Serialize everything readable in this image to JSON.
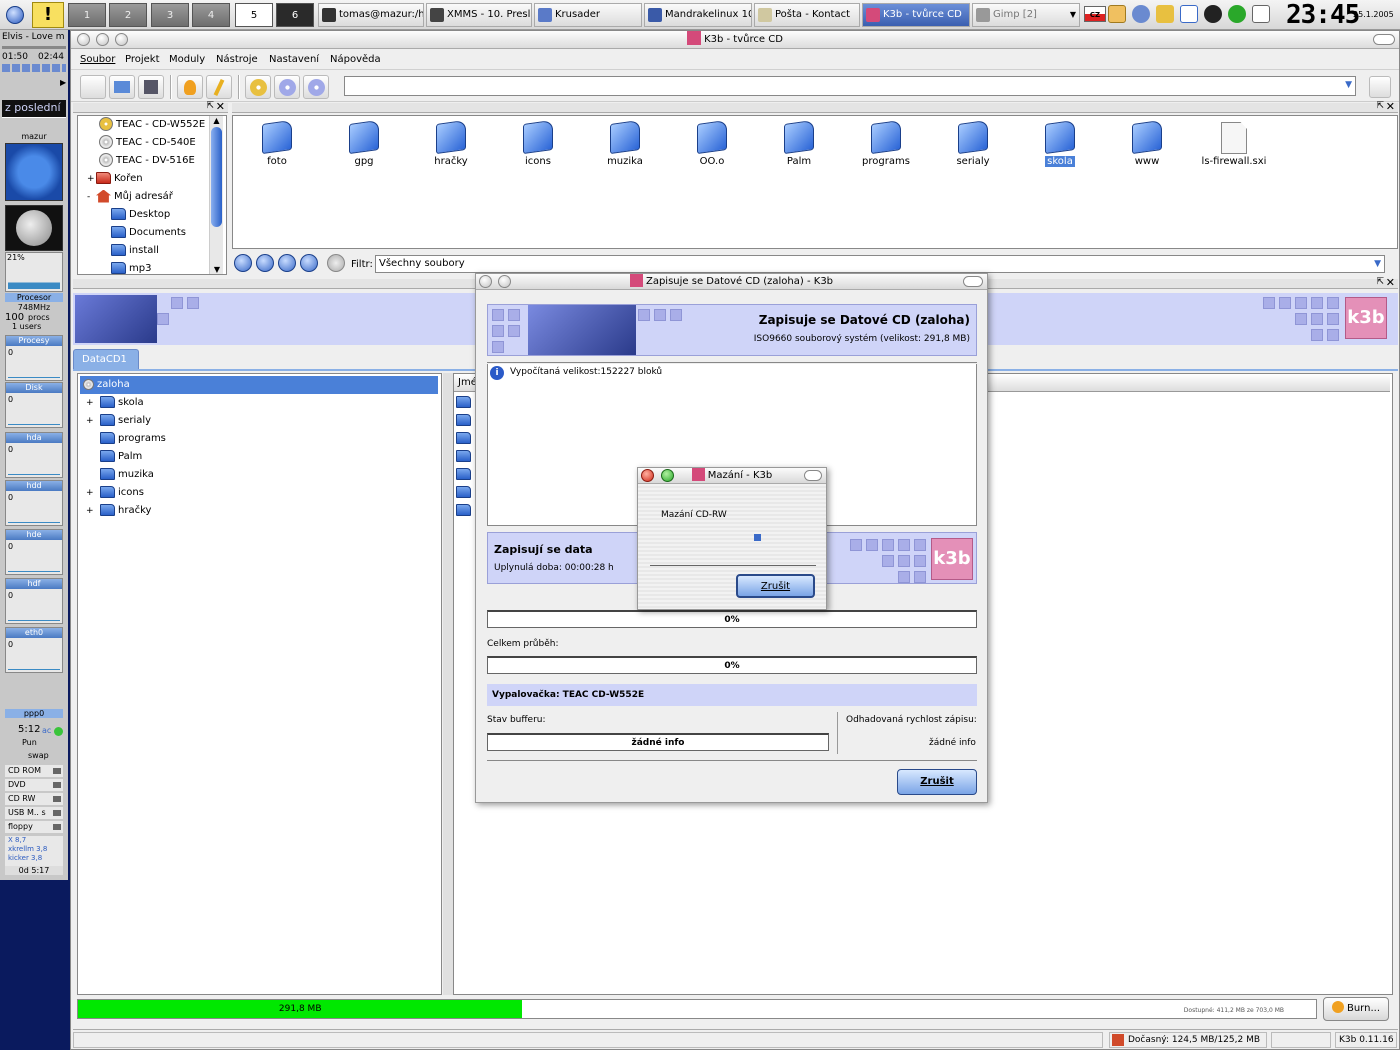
{
  "taskbar": {
    "desktops": [
      "1",
      "2",
      "3",
      "4",
      "5",
      "6"
    ],
    "tasks": [
      {
        "label": "tomas@mazur:/h"
      },
      {
        "label": "XMMS - 10. Presl"
      },
      {
        "label": "Krusader"
      },
      {
        "label": "Mandrakelinux 10"
      },
      {
        "label": "Pošta - Kontact"
      },
      {
        "label": "K3b - tvůrce CD"
      },
      {
        "label": "Gimp [2]"
      }
    ],
    "keyboard_layout": "CZ",
    "clock": "23:45",
    "date": "25.1.2005"
  },
  "dock": {
    "xmms_title": "Elvis - Love m",
    "xmms_time_elapsed": "01:50",
    "xmms_time_total": "02:44",
    "ticker": "z poslední",
    "host": "mazur",
    "cpu_percent": "21%",
    "cpu_label": "Procesor",
    "cpu_freq": "748MHz",
    "procs_count": "100",
    "procs_unit": "procs",
    "users": "1 users",
    "monitors": [
      {
        "label": "Procesy",
        "value": "0"
      },
      {
        "label": "Disk",
        "value": "0"
      },
      {
        "label": "hda",
        "value": "0"
      },
      {
        "label": "hdd",
        "value": "0"
      },
      {
        "label": "hde",
        "value": "0"
      },
      {
        "label": "hdf",
        "value": "0"
      },
      {
        "label": "eth0",
        "value": "0"
      }
    ],
    "ppp_label": "ppp0",
    "ppp_time": "5:12",
    "ppp_unit": "ac",
    "pun": "Pun",
    "swap": "swap",
    "mounts": [
      "CD ROM",
      "DVD",
      "CD RW",
      "USB M.. s",
      "floppy"
    ],
    "mem": [
      "X 8,7",
      "xkrellm 3,8",
      "kicker 3,8"
    ],
    "uptime": "0d 5:17"
  },
  "window": {
    "title": "K3b - tvůrce CD",
    "menu": [
      "Soubor",
      "Projekt",
      "Moduly",
      "Nástroje",
      "Nastavení",
      "Nápověda"
    ],
    "device_tree": [
      {
        "label": "TEAC - CD-W552E",
        "icon": "cd-burner-icon"
      },
      {
        "label": "TEAC - CD-540E",
        "icon": "cdrom-icon"
      },
      {
        "label": "TEAC - DV-516E",
        "icon": "dvd-icon"
      },
      {
        "label": "Kořen",
        "icon": "root-folder-icon"
      },
      {
        "label": "Můj adresář",
        "icon": "home-icon"
      },
      {
        "label": "Desktop",
        "icon": "desktop-icon"
      },
      {
        "label": "Documents",
        "icon": "folder-icon"
      },
      {
        "label": "install",
        "icon": "folder-icon"
      },
      {
        "label": "mp3",
        "icon": "folder-icon"
      }
    ],
    "files": [
      "foto",
      "gpg",
      "hračky",
      "icons",
      "muzika",
      "OO.o",
      "Palm",
      "programs",
      "serialy",
      "skola",
      "www",
      "ls-firewall.sxi"
    ],
    "selected_file": "skola",
    "filter_label": "Filtr:",
    "filter_value": "Všechny soubory",
    "project_tab": "DataCD1",
    "project_root": "zaloha",
    "project_items": [
      "skola",
      "serialy",
      "programs",
      "Palm",
      "muzika",
      "icons",
      "hračky"
    ],
    "list_header": "Jmé",
    "size_used": "291,8 MB",
    "size_used_fraction": 0.359,
    "size_available": "Dostupné: 411,2 MB ze 703,0 MB",
    "burn_button": "Burn...",
    "status_temp": "Dočasný: 124,5 MB/125,2 MB",
    "status_version": "K3b 0.11.16"
  },
  "burn_dialog": {
    "title": "Zapisuje se Datové CD (zaloha) - K3b",
    "heading": "Zapisuje se Datové CD (zaloha)",
    "subheading": "ISO9660 souborový systém (velikost: 291,8 MB)",
    "log_line": "Vypočítaná velikost:152227 bloků",
    "status_heading": "Zapisují se data",
    "elapsed": "Uplynulá doba: 00:00:28 h",
    "track_progress": "0%",
    "track_fraction": 0,
    "overall_label": "Celkem průběh:",
    "overall_progress": "0%",
    "overall_fraction": 0,
    "writer": "Vypalovačka: TEAC CD-W552E",
    "buffer_label": "Stav bufferu:",
    "buffer_value": "žádné info",
    "speed_label": "Odhadovaná rychlost zápisu:",
    "speed_value": "žádné info",
    "cancel": "Zrušit"
  },
  "erase_dialog": {
    "title": "Mazání - K3b",
    "message": "Mazání CD-RW",
    "cancel": "Zrušit"
  }
}
